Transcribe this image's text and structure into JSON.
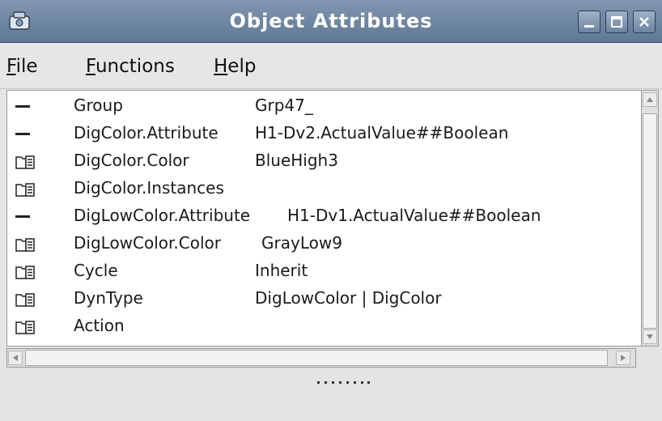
{
  "window": {
    "title": "Object Attributes",
    "icon": "app-icon",
    "controls": [
      "minimize-icon",
      "maximize-icon",
      "close-icon"
    ]
  },
  "menu": {
    "file": {
      "mnemonic": "F",
      "rest": "ile"
    },
    "functions": {
      "mnemonic": "F",
      "rest": "unctions"
    },
    "help": {
      "mnemonic": "H",
      "rest": "elp"
    }
  },
  "attributes": [
    {
      "icon": "dash-icon",
      "name": "Group",
      "value": "Grp47_"
    },
    {
      "icon": "dash-icon",
      "name": "DigColor.Attribute",
      "value": "H1-Dv2.ActualValue##Boolean"
    },
    {
      "icon": "folder-icon",
      "name": "DigColor.Color",
      "value": "BlueHigh3"
    },
    {
      "icon": "folder-icon",
      "name": "DigColor.Instances",
      "value": ""
    },
    {
      "icon": "dash-icon",
      "name": "DigLowColor.Attribute",
      "value": "H1-Dv1.ActualValue##Boolean"
    },
    {
      "icon": "folder-icon",
      "name": "DigLowColor.Color",
      "value": "GrayLow9"
    },
    {
      "icon": "folder-icon",
      "name": "Cycle",
      "value": "Inherit"
    },
    {
      "icon": "folder-icon",
      "name": "DynType",
      "value": "DigLowColor | DigColor"
    },
    {
      "icon": "folder-icon",
      "name": "Action",
      "value": ""
    }
  ],
  "colors": {
    "titlebar": "#6f86a3",
    "background": "#e4e4e4",
    "list_background": "#ffffff"
  }
}
